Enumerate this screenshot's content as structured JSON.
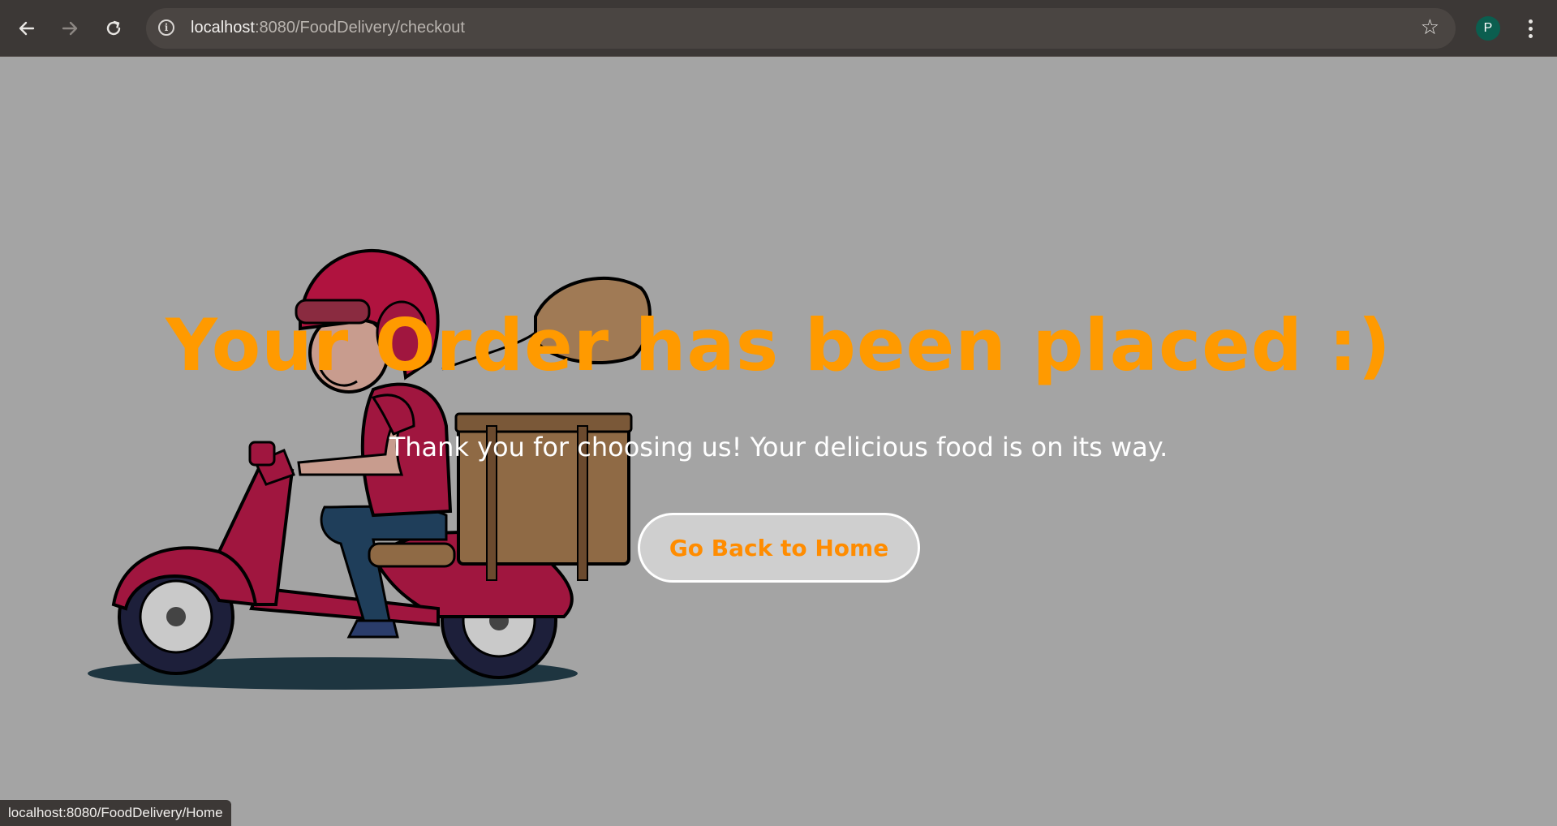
{
  "browser": {
    "url_host": "localhost",
    "url_rest": ":8080/FoodDelivery/checkout",
    "profile_initial": "P",
    "status_url": "localhost:8080/FoodDelivery/Home"
  },
  "icons": {
    "back": "arrow-left",
    "forward": "arrow-right",
    "reload": "reload",
    "site_info": "info",
    "bookmark": "star",
    "menu": "vertical-dots"
  },
  "page": {
    "headline": "Your Order has been placed :)",
    "message": "Thank you for choosing us! Your delicious food is on its way.",
    "home_button_label": "Go Back to Home"
  },
  "colors": {
    "headline": "#ff9a00",
    "button_text": "#ff8c00",
    "page_background": "#a4a4a4",
    "scooter": "#a0163f",
    "avatar": "#0b5e4f"
  }
}
